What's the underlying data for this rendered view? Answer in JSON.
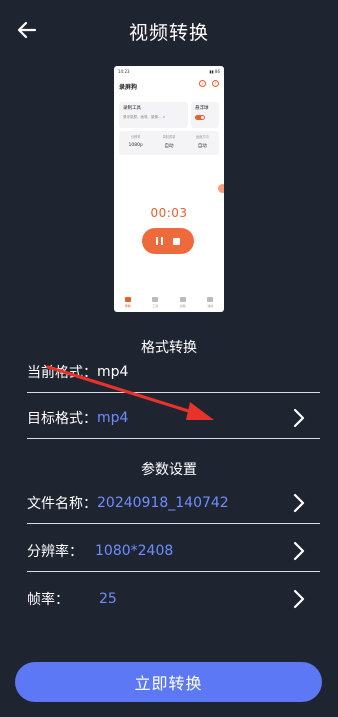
{
  "header": {
    "title": "视频转换",
    "back_icon": "arrow-left-icon"
  },
  "preview": {
    "status_time": "14:23",
    "status_right": "▮▮ 86",
    "app_name": "录屏狗",
    "card_record_title": "录制工具",
    "card_record_sub": "悬浮录屏、画笔、摄像… >",
    "card_toggle_title": "悬浮球",
    "stats": [
      {
        "label": "分辨率",
        "value": "1080p"
      },
      {
        "label": "录制质量",
        "value": "自动"
      },
      {
        "label": "画面方向",
        "value": "自动"
      }
    ],
    "timer": "00:03",
    "tabs": [
      "录制",
      "工具",
      "剪辑",
      "我的"
    ],
    "accent": "#e8602c"
  },
  "format_section": {
    "title": "格式转换",
    "current_label": "当前格式：",
    "current_value": "mp4",
    "target_label": "目标格式：",
    "target_value": "mp4"
  },
  "params_section": {
    "title": "参数设置",
    "filename_label": "文件名称：",
    "filename_value": "20240918_140742",
    "resolution_label": "分辨率：",
    "resolution_value": "1080*2408",
    "framerate_label": "帧率：",
    "framerate_value": "25"
  },
  "convert_button": "立即转换",
  "colors": {
    "background": "#1f2431",
    "accent_blue": "#5c78f5",
    "value_blue": "#6f8dff",
    "annotation_red": "#e8332a"
  }
}
